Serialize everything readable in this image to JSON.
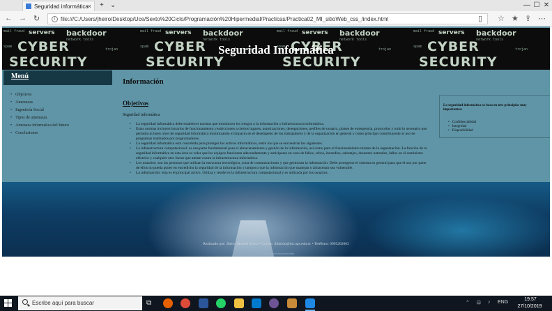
{
  "browser": {
    "tab_title": "Seguridad informática",
    "tab_close": "×",
    "new_tab": "+",
    "tab_menu": "⌄",
    "url": "file:///C:/Users/jheiro/Desktop/Uce/Sexto%20Ciclo/Programación%20Hipermedial/Practicas/Practica02_MI_sitioWeb_css_/index.html",
    "nav": {
      "back": "←",
      "forward": "→",
      "refresh": "↻"
    },
    "window": {
      "minimize": "—",
      "maximize": "☐",
      "close": "✕"
    }
  },
  "site": {
    "title": "Seguridad Informática",
    "banner_words": [
      "CYBER",
      "SECURITY",
      "servers",
      "backdoor",
      "tools"
    ]
  },
  "menu": {
    "title": "Menú",
    "items": [
      "Objetivos",
      "Amenazas",
      "Ingeniería Social",
      "Tipos de amenazas",
      "Amenaza informática del futuro",
      "Conclusiones"
    ]
  },
  "main": {
    "title": "Información",
    "section_title": "Objetivos",
    "section_subtitle": "Seguridad informática",
    "bullets": [
      "La seguridad informática debe establecer normas que minimicen los riesgos a la información o infraestructura informática.",
      "Estas normas incluyen horarios de funcionamiento, restricciones a ciertos lugares, autorizaciones, denegaciones, perfiles de usuario, planes de emergencia, protocolos y todo lo necesario que permita un buen nivel de seguridad informática minimizando el impacto en el desempeño de los trabajadores y de la organización en general y como principal contribuyente al uso de programas realizados por programadores.",
      "La seguridad informática está concebida para proteger los activos informáticos, entre los que se encuentran los siguientes.",
      "La infraestructura computacional: es una parte fundamental para el almacenamiento y gestión de la información, así como para el funcionamiento mismo de la organización. La función de la seguridad informática en esta área es velar que los equipos funcionen adecuadamente y anticiparse en caso de fallos, robos, incendios, sabotajes, desastres naturales, fallos en el suministro eléctrico y cualquier otro factor que atente contra la infraestructura informática.",
      "Los usuarios: son las personas que utilizan la estructura tecnológica, zona de comunicaciones y que gestionan la información. Debe protegerse el sistema en general para que el uso por parte de ellos no pueda poner en entredicho la seguridad de la información y tampoco que la información que manejan o almacenan sea vulnerable.",
      "La información: esta es el principal activo. Utiliza y reside en la infraestructura computacional y es utilizada por los usuarios."
    ]
  },
  "aside": {
    "intro": "La seguridad informática se basa en tres principios muy importantes:",
    "items": [
      "Confidencialidad",
      "Integridad",
      "Disponibilidad"
    ]
  },
  "footer": {
    "text": "Realizado por: Jheiro Madrid Nulco • Correo: jhlimdo@est.ups.edu.ec • Teléfono: 0995262003",
    "sub": "© Todos los derechos reservados"
  },
  "taskbar": {
    "search_placeholder": "Escribe aquí para buscar",
    "time": "19:57",
    "date": "27/10/2019",
    "lang": "ENG",
    "apps": [
      {
        "name": "firefox-icon",
        "color": "#e66000"
      },
      {
        "name": "chrome-icon",
        "color": "#dd4b39"
      },
      {
        "name": "word-icon",
        "color": "#2b579a"
      },
      {
        "name": "whatsapp-icon",
        "color": "#25d366"
      },
      {
        "name": "explorer-icon",
        "color": "#f0c040"
      },
      {
        "name": "vscode-icon",
        "color": "#007acc"
      },
      {
        "name": "github-icon",
        "color": "#6e5494"
      },
      {
        "name": "photos-icon",
        "color": "#c98a3a"
      },
      {
        "name": "edge-icon",
        "color": "#1e88e5"
      }
    ]
  }
}
